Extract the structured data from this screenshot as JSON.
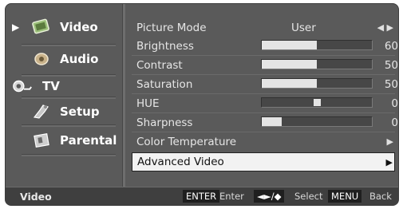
{
  "sidebar": {
    "items": [
      {
        "label": "Video",
        "icon": "video-icon",
        "selected": true
      },
      {
        "label": "Audio",
        "icon": "audio-icon"
      },
      {
        "label": "TV",
        "icon": "tv-icon"
      },
      {
        "label": "Setup",
        "icon": "setup-icon"
      },
      {
        "label": "Parental",
        "icon": "parental-icon"
      }
    ]
  },
  "menu": {
    "picture_mode": {
      "label": "Picture Mode",
      "value": "User"
    },
    "brightness": {
      "label": "Brightness",
      "value": "60",
      "level": 0.5
    },
    "contrast": {
      "label": "Contrast",
      "value": "50",
      "level": 0.5
    },
    "saturation": {
      "label": "Saturation",
      "value": "50",
      "level": 0.5
    },
    "hue": {
      "label": "HUE",
      "value": "0",
      "level": 0.5
    },
    "sharpness": {
      "label": "Sharpness",
      "value": "0",
      "level": 0.18
    },
    "color_temperature": {
      "label": "Color Temperature"
    },
    "advanced_video": {
      "label": "Advanced Video",
      "selected": true
    }
  },
  "footer": {
    "title": "Video",
    "enter_key": "ENTER",
    "enter_text": "Enter",
    "select_key": "◄►/◆",
    "select_text": "Select",
    "menu_key": "MENU",
    "menu_text": "Back"
  },
  "colors": {
    "background": "#5a5a5a",
    "footer": "#3f3f3f",
    "highlight": "#f2f2f2"
  }
}
